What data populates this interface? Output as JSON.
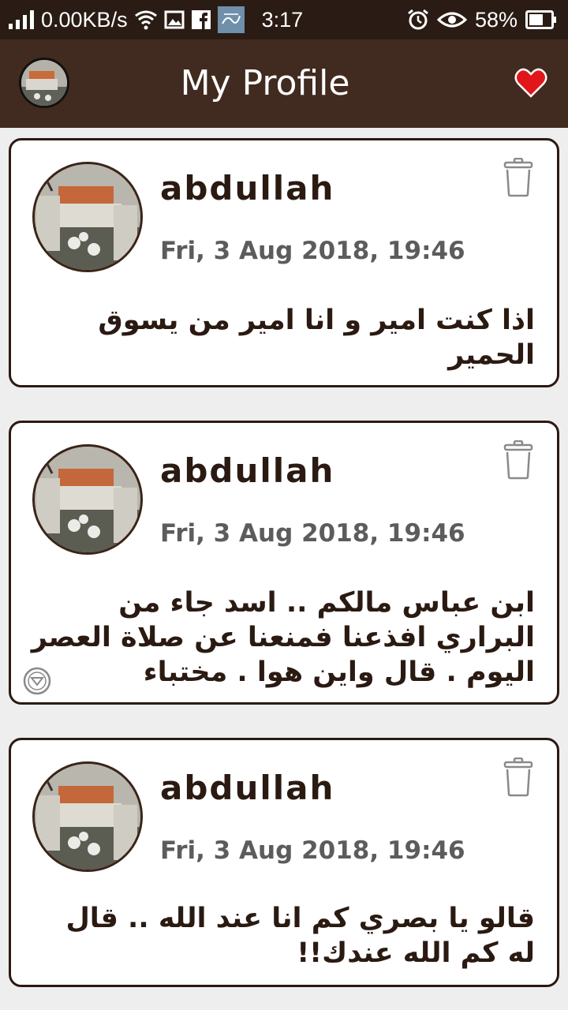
{
  "status_bar": {
    "net_speed": "0.00KB/s",
    "time": "3:17",
    "battery": "58%",
    "icons": [
      "signal-icon",
      "wifi-icon",
      "image-icon",
      "facebook-icon",
      "app-notification-icon",
      "alarm-icon",
      "eye-icon",
      "battery-icon"
    ]
  },
  "app_bar": {
    "title": "My Profile",
    "icons": [
      "avatar",
      "heart-icon"
    ],
    "accent_color": "#412a1f",
    "heart_color": "#e0161b"
  },
  "posts": [
    {
      "name": "abdullah",
      "date": "Fri, 3 Aug 2018, 19:46",
      "text": "اذا كنت امير و انا امير من يسوق الحمير"
    },
    {
      "name": "abdullah",
      "date": "Fri, 3 Aug 2018, 19:46",
      "text": "ابن عباس مالكم .. اسد جاء من البراري افذعنا فمنعنا عن صلاة العصر اليوم . قال واين هوا . مختباء"
    },
    {
      "name": "abdullah",
      "date": "Fri, 3 Aug 2018, 19:46",
      "text": "قالو يا بصري كم انا عند الله .. قال له كم الله عندك!!"
    }
  ]
}
